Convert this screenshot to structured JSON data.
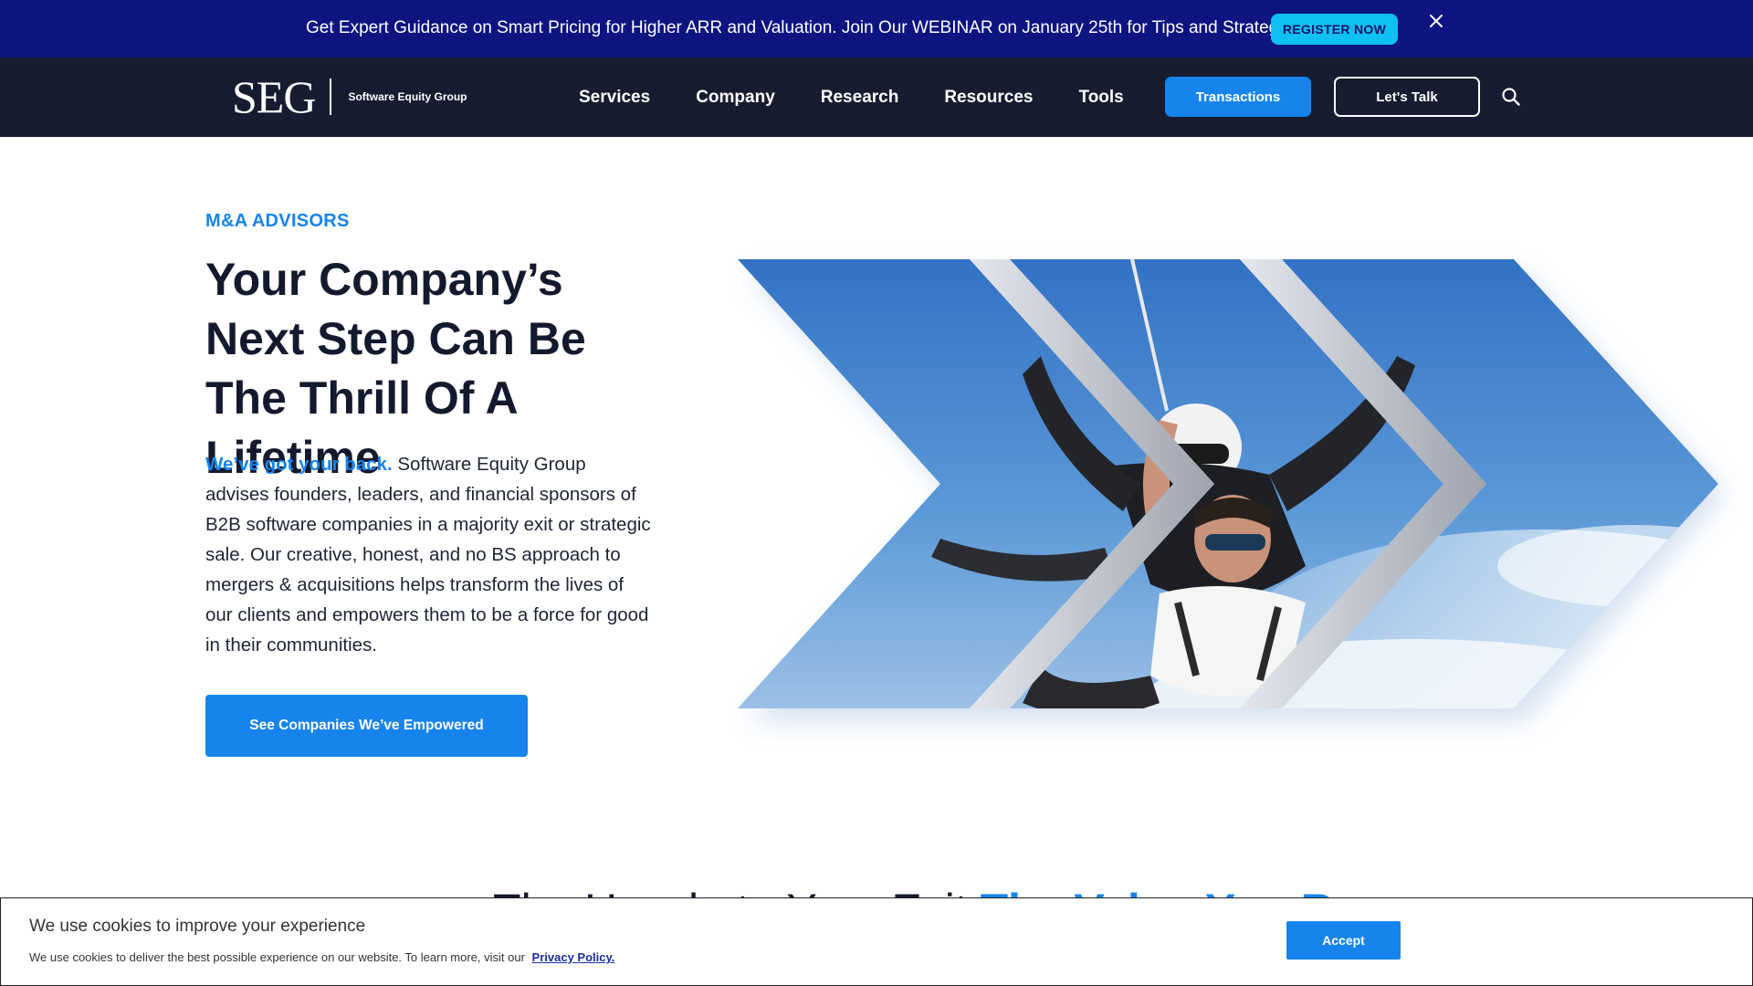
{
  "announcement": {
    "text": "Get Expert Guidance on Smart Pricing for Higher ARR and Valuation. Join Our WEBINAR on January 25th for Tips and Strategies",
    "register_label": "REGISTER NOW",
    "close_icon": "close-icon"
  },
  "nav": {
    "logo_mark": "SEG",
    "logo_sub": "Software Equity Group",
    "links": [
      "Services",
      "Company",
      "Research",
      "Resources",
      "Tools"
    ],
    "transactions_label": "Transactions",
    "talk_label": "Let's Talk",
    "search_icon": "search-icon"
  },
  "hero": {
    "eyebrow": "M&A ADVISORS",
    "headline": "Your Company’s Next Step Can Be The Thrill Of A Lifetime",
    "lead": "We’ve got your back.",
    "body": " Software Equity Group advises founders, leaders, and financial sponsors of B2B software companies in a majority exit or strategic sale. Our creative, honest, and no BS approach to mergers & acquisitions helps transform the lives of our clients and empowers them to be a force for good in their communities.",
    "cta_label": "See Companies We’ve Empowered"
  },
  "section": {
    "heading_start": "The Hassle to Your Exit",
    "heading_accent": "The Value You R"
  },
  "cookie": {
    "title": "We use cookies to improve your experience",
    "text": "We use cookies to deliver the best possible experience on our website. To learn more, visit our",
    "link_label": "Privacy Policy.",
    "accept_label": "Accept"
  },
  "colors": {
    "announcement_bg": "#0e1480",
    "nav_bg": "#171c30",
    "accent": "#1684ec",
    "register_bg": "#0fc0f2"
  }
}
